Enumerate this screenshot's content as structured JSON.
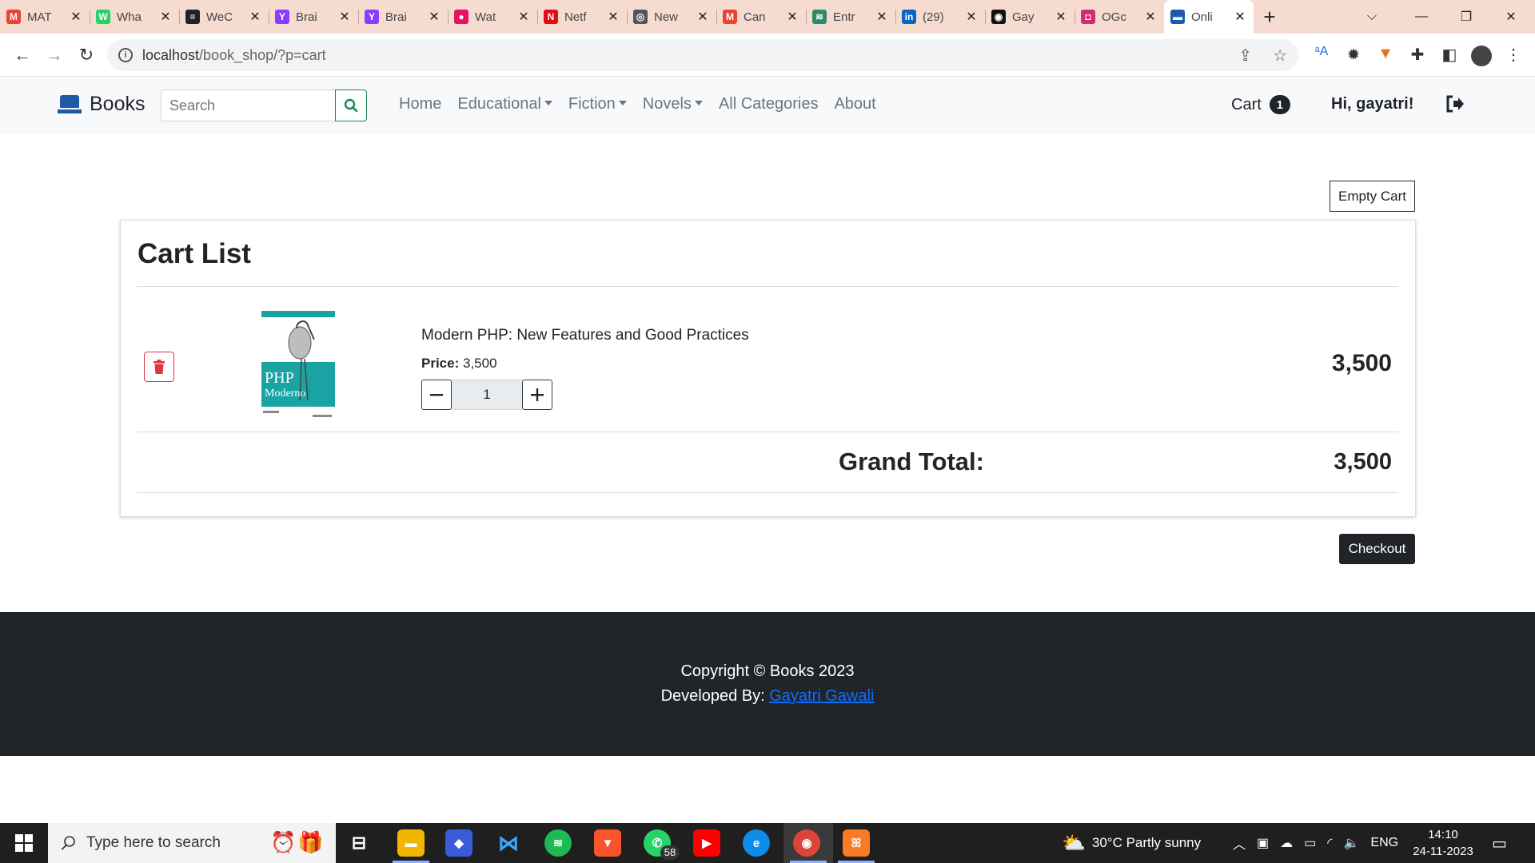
{
  "browser": {
    "tabs": [
      {
        "title": "MAT",
        "icon": "gmail-icon",
        "color": "#ea4335",
        "glyph": "M"
      },
      {
        "title": "Wha",
        "icon": "whatsapp-icon",
        "color": "#25d366",
        "glyph": "W"
      },
      {
        "title": "WeC",
        "icon": "wecode-icon",
        "color": "#222222",
        "glyph": "≡"
      },
      {
        "title": "Brai",
        "icon": "brainly-icon",
        "color": "#8b3dff",
        "glyph": "Y"
      },
      {
        "title": "Brai",
        "icon": "brainly-icon",
        "color": "#8b3dff",
        "glyph": "Y"
      },
      {
        "title": "Wat",
        "icon": "watch-icon",
        "color": "#e4145f",
        "glyph": "●"
      },
      {
        "title": "Netf",
        "icon": "netflix-icon",
        "color": "#e50914",
        "glyph": "N"
      },
      {
        "title": "New",
        "icon": "chrome-newtab-icon",
        "color": "#555555",
        "glyph": "◎"
      },
      {
        "title": "Can",
        "icon": "gmail-icon",
        "color": "#ea4335",
        "glyph": "M"
      },
      {
        "title": "Entr",
        "icon": "wifi-icon",
        "color": "#2a8c6a",
        "glyph": "≋"
      },
      {
        "title": "(29)",
        "icon": "linkedin-icon",
        "color": "#0a66c2",
        "glyph": "in"
      },
      {
        "title": "Gay",
        "icon": "github-icon",
        "color": "#111111",
        "glyph": "◉"
      },
      {
        "title": "OGc",
        "icon": "instagram-icon",
        "color": "#d62976",
        "glyph": "◘"
      },
      {
        "title": "Onli",
        "icon": "books-favicon-icon",
        "color": "#1e5aa8",
        "glyph": "▬",
        "active": true
      }
    ],
    "url_host": "localhost",
    "url_path": "/book_shop/?p=cart"
  },
  "site": {
    "brand": "Books",
    "search_placeholder": "Search",
    "nav": {
      "home": "Home",
      "educational": "Educational",
      "fiction": "Fiction",
      "novels": "Novels",
      "all_categories": "All Categories",
      "about": "About"
    },
    "cart_label": "Cart",
    "cart_count": "1",
    "greeting": "Hi, gayatri!"
  },
  "cart": {
    "empty_label": "Empty Cart",
    "title": "Cart List",
    "items": [
      {
        "title": "Modern PHP: New Features and Good Practices",
        "price_label": "Price:",
        "price": "3,500",
        "quantity": "1",
        "total": "3,500",
        "cover_title": "PHP",
        "cover_subtitle": "Moderno"
      }
    ],
    "grand_total_label": "Grand Total:",
    "grand_total": "3,500",
    "checkout_label": "Checkout"
  },
  "footer": {
    "copyright": "Copyright © Books 2023",
    "developed_by": "Developed By:",
    "developer": "Gayatri Gawali"
  },
  "taskbar": {
    "search_placeholder": "Type here to search",
    "whatsapp_badge": "58",
    "weather": "30°C  Partly sunny",
    "language": "ENG",
    "time": "14:10",
    "date": "24-11-2023"
  },
  "colors": {
    "accent_green": "#198754",
    "danger_red": "#dc3545",
    "dark": "#212529",
    "link_blue": "#0d6efd",
    "cover_teal": "#1aa3a3"
  }
}
